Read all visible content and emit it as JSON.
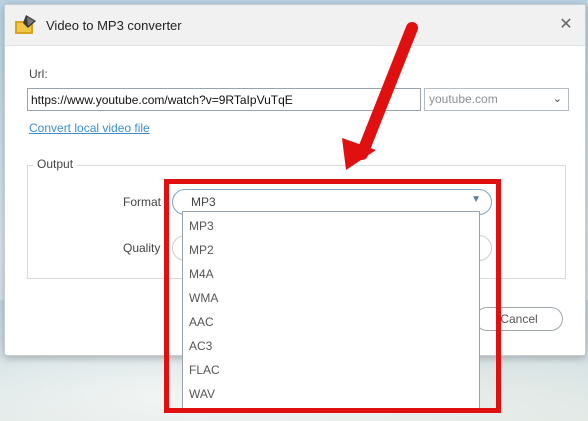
{
  "window": {
    "title": "Video to MP3 converter",
    "close_symbol": "✕"
  },
  "url": {
    "label": "Url:",
    "value": "https://www.youtube.com/watch?v=9RTaIpVuTqE"
  },
  "site_select": {
    "value": "youtube.com"
  },
  "convert_link": "Convert local video file",
  "output": {
    "legend": "Output",
    "format_label": "Format",
    "quality_label": "Quality",
    "format_value": "MP3",
    "format_options": [
      "MP3",
      "MP2",
      "M4A",
      "WMA",
      "AAC",
      "AC3",
      "FLAC",
      "WAV"
    ]
  },
  "cancel_label": "Cancel",
  "colors": {
    "annotation": "#e01010",
    "link": "#3b8fd1"
  }
}
